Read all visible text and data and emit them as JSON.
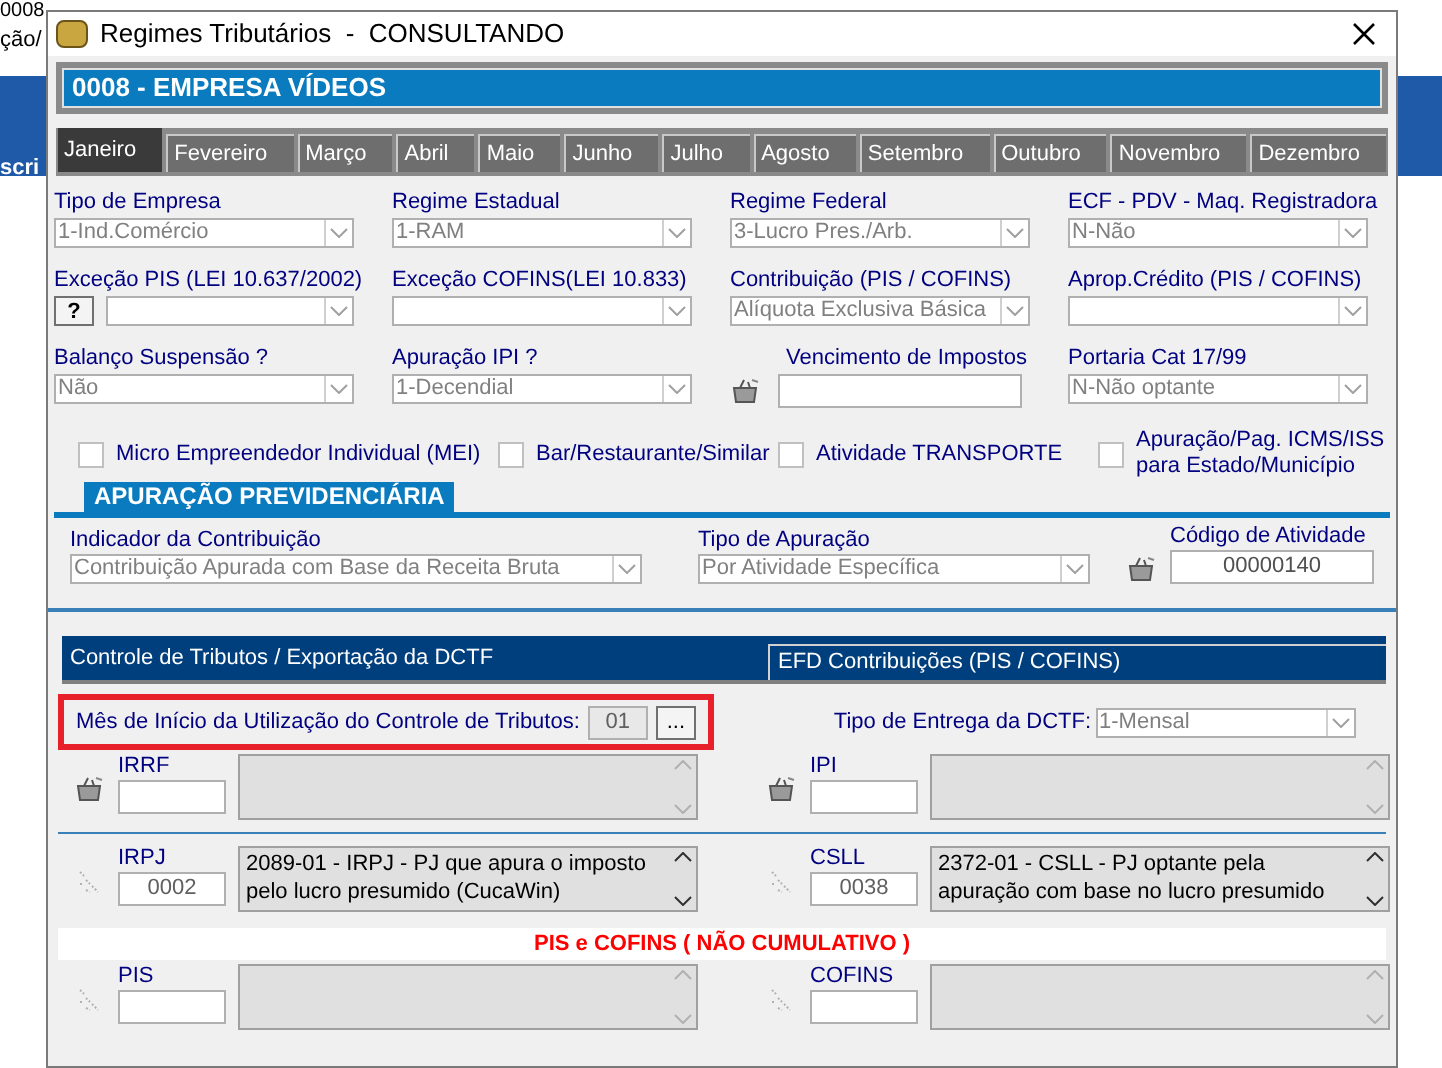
{
  "background": {
    "texts": [
      "0008",
      "ção/",
      "scri"
    ]
  },
  "window": {
    "title": "Regimes Tributários  -  CONSULTANDO"
  },
  "company": "0008 - EMPRESA VÍDEOS",
  "months": [
    {
      "label": "Janeiro",
      "selected": true
    },
    {
      "label": "Fevereiro",
      "selected": false
    },
    {
      "label": "Março",
      "selected": false
    },
    {
      "label": "Abril",
      "selected": false
    },
    {
      "label": "Maio",
      "selected": false
    },
    {
      "label": "Junho",
      "selected": false
    },
    {
      "label": "Julho",
      "selected": false
    },
    {
      "label": "Agosto",
      "selected": false
    },
    {
      "label": "Setembro",
      "selected": false
    },
    {
      "label": "Outubro",
      "selected": false
    },
    {
      "label": "Novembro",
      "selected": false
    },
    {
      "label": "Dezembro",
      "selected": false
    }
  ],
  "fields": [
    {
      "label": "Tipo de Empresa",
      "value": "1-Ind.Comércio",
      "kind": "select"
    },
    {
      "label": "Regime Estadual",
      "value": "1-RAM",
      "kind": "select"
    },
    {
      "label": "Regime Federal",
      "value": "3-Lucro Pres./Arb.",
      "kind": "select"
    },
    {
      "label": "ECF - PDV - Maq. Registradora",
      "value": "N-Não",
      "kind": "select"
    },
    {
      "label": "Exceção PIS (LEI 10.637/2002)",
      "help": "?",
      "kind": "help-select"
    },
    {
      "label": "Exceção COFINS(LEI 10.833)",
      "kind": "select"
    },
    {
      "label": "Contribuição (PIS / COFINS)",
      "value": "Alíquota Exclusiva Básica",
      "kind": "select"
    },
    {
      "label": "Aprop.Crédito (PIS / COFINS)",
      "kind": "select"
    },
    {
      "label": "Balanço Suspensão ?",
      "value": "Não",
      "kind": "select"
    },
    {
      "label": "Apuração IPI ?",
      "value": "1-Decendial",
      "kind": "select"
    },
    {
      "label": "Vencimento de Impostos",
      "kind": "icon-text"
    },
    {
      "label": "Portaria Cat 17/99",
      "value": "N-Não optante",
      "kind": "select"
    }
  ],
  "checkboxes": [
    {
      "label": "Micro Empreendedor Individual (MEI)",
      "checked": false
    },
    {
      "label": "Bar/Restaurante/Similar",
      "checked": false
    },
    {
      "label": "Atividade TRANSPORTE",
      "checked": false
    },
    {
      "label": "Apuração/Pag. ICMS/ISS para Estado/Município",
      "checked": false
    }
  ],
  "previdenciaria": {
    "title": "APURAÇÃO PREVIDENCIÁRIA",
    "indicador": {
      "label": "Indicador da Contribuição",
      "value": "Contribuição Apurada com Base da Receita Bruta"
    },
    "tipo": {
      "label": "Tipo de Apuração",
      "value": "Por Atividade Específica"
    },
    "codigo": {
      "label": "Código de Atividade",
      "value": "00000140"
    }
  },
  "subtabs": [
    {
      "label": "Controle de Tributos / Exportação da DCTF",
      "selected": true
    },
    {
      "label": "EFD Contribuições (PIS / COFINS)",
      "selected": false
    }
  ],
  "mes_inicio": {
    "label": "Mês de Início da Utilização do Controle de Tributos:",
    "value": "01",
    "button": "..."
  },
  "tipo_entrega": {
    "label": "Tipo de Entrega da DCTF:",
    "value": "1-Mensal"
  },
  "taxes": [
    {
      "label": "IRRF",
      "kind": "editable"
    },
    {
      "label": "IPI",
      "kind": "editable"
    },
    {
      "label": "IRPJ",
      "code": "0002",
      "description": "2089-01 - IRPJ - PJ que apura o imposto pelo lucro presumido (CucaWin)",
      "kind": "locked"
    },
    {
      "label": "CSLL",
      "code": "0038",
      "description": "2372-01 - CSLL - PJ optante pela apuração com base no lucro presumido",
      "kind": "locked"
    }
  ],
  "pis_cofins": {
    "title": "PIS e COFINS ( NÃO CUMULATIVO )",
    "taxes": [
      {
        "label": "PIS",
        "kind": "locked"
      },
      {
        "label": "COFINS",
        "kind": "locked"
      }
    ]
  }
}
